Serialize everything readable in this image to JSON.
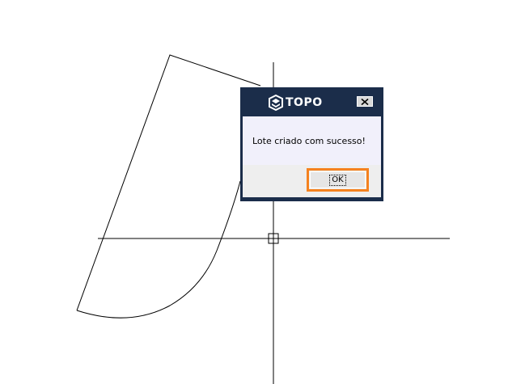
{
  "dialog": {
    "brand": "TOPO",
    "message": "Lote criado com sucesso!",
    "ok_label": "OK",
    "close_icon": "close-icon",
    "logo_icon": "topo-logo-icon"
  },
  "colors": {
    "titlebar": "#1b2d4a",
    "message_bg": "#f1f0fb",
    "footer_bg": "#eeeeee",
    "highlight": "#f5821f",
    "drawing_lines": "#000000"
  }
}
